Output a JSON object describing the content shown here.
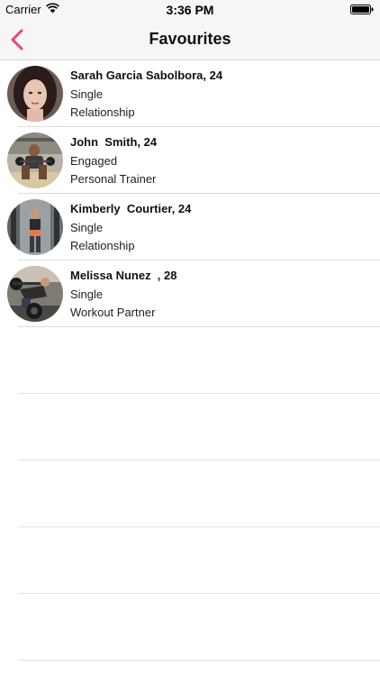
{
  "status_bar": {
    "carrier": "Carrier",
    "time": "3:36 PM",
    "icons": [
      "wifi-icon",
      "battery-icon"
    ]
  },
  "nav": {
    "title": "Favourites",
    "back_icon": "chevron-left-icon",
    "accent_color": "#e5467e"
  },
  "favourites": [
    {
      "name": "Sarah Garcia Sabolbora, 24",
      "status": "Single",
      "looking_for": "Relationship"
    },
    {
      "name": "John  Smith, 24",
      "status": "Engaged",
      "looking_for": "Personal Trainer"
    },
    {
      "name": "Kimberly  Courtier, 24",
      "status": "Single",
      "looking_for": "Relationship"
    },
    {
      "name": "Melissa Nunez  , 28",
      "status": "Single",
      "looking_for": "Workout Partner"
    }
  ]
}
